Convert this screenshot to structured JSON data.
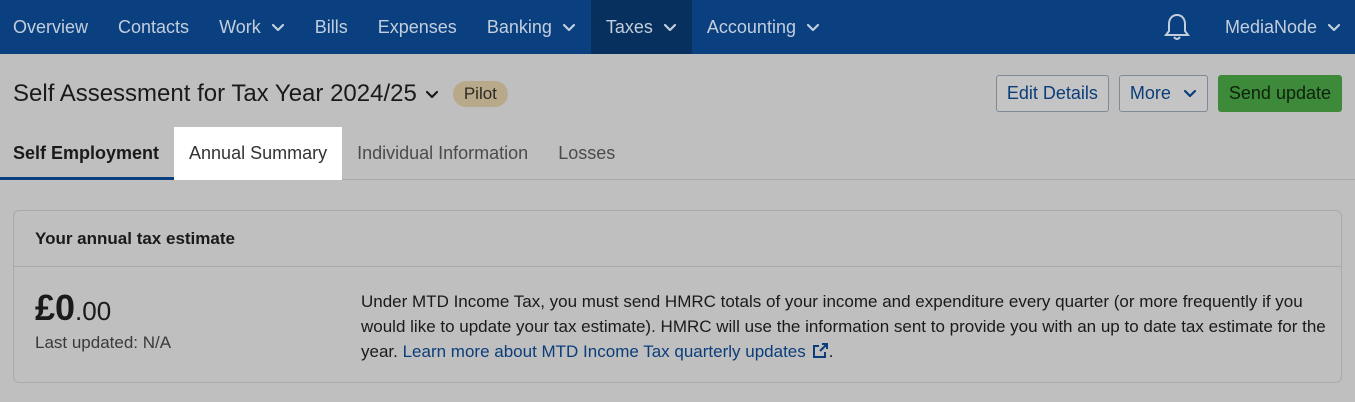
{
  "nav": {
    "items": [
      {
        "label": "Overview",
        "has_menu": false
      },
      {
        "label": "Contacts",
        "has_menu": false
      },
      {
        "label": "Work",
        "has_menu": true
      },
      {
        "label": "Bills",
        "has_menu": false
      },
      {
        "label": "Expenses",
        "has_menu": false
      },
      {
        "label": "Banking",
        "has_menu": true
      },
      {
        "label": "Taxes",
        "has_menu": true,
        "active": true
      },
      {
        "label": "Accounting",
        "has_menu": true
      }
    ],
    "user_label": "MediaNode"
  },
  "header": {
    "title": "Self Assessment for Tax Year 2024/25",
    "badge": "Pilot",
    "edit_label": "Edit Details",
    "more_label": "More",
    "send_label": "Send update"
  },
  "tabs": [
    {
      "label": "Self Employment",
      "selected": true
    },
    {
      "label": "Annual Summary",
      "highlight": true
    },
    {
      "label": "Individual Information"
    },
    {
      "label": "Losses"
    }
  ],
  "card": {
    "title": "Your annual tax estimate",
    "amount_main": "£0",
    "amount_pence": ".00",
    "last_updated": "Last updated: N/A",
    "description": "Under MTD Income Tax, you must send HMRC totals of your income and expenditure every quarter (or more frequently if you would like to update your tax estimate). HMRC will use the information sent to provide you with an up to date tax estimate for the year. ",
    "link_text": "Learn more about MTD Income Tax quarterly updates",
    "trailing": "."
  },
  "colors": {
    "nav_bg": "#0a4080",
    "nav_active_bg": "#07305f",
    "primary_button": "#3d8a3a",
    "link": "#0b3d7a",
    "badge_bg": "#b8a98a"
  }
}
